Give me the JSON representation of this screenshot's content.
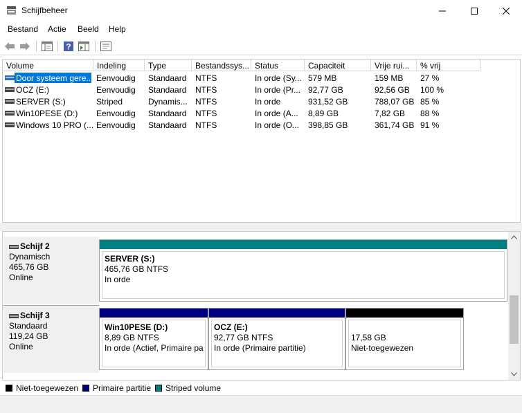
{
  "window": {
    "title": "Schijfbeheer",
    "minimize_icon": "minimize-icon",
    "maximize_icon": "maximize-icon",
    "close_icon": "close-icon"
  },
  "menu": [
    "Bestand",
    "Actie",
    "Beeld",
    "Help"
  ],
  "toolbar": [
    "back-arrow-icon",
    "forward-arrow-icon",
    "console-tree-icon",
    "help-icon",
    "action-pane-icon",
    "properties-icon"
  ],
  "volumes": {
    "columns": [
      "Volume",
      "Indeling",
      "Type",
      "Bestandssys...",
      "Status",
      "Capaciteit",
      "Vrije rui...",
      "% vrij"
    ],
    "rows": [
      {
        "volume": "Door systeem gere...",
        "indeling": "Eenvoudig",
        "type": "Standaard",
        "fs": "NTFS",
        "status": "In orde (Sy...",
        "capaciteit": "579 MB",
        "vrij": "159 MB",
        "pct": "27 %"
      },
      {
        "volume": "OCZ (E:)",
        "indeling": "Eenvoudig",
        "type": "Standaard",
        "fs": "NTFS",
        "status": "In orde (Pr...",
        "capaciteit": "92,77 GB",
        "vrij": "92,56 GB",
        "pct": "100 %"
      },
      {
        "volume": "SERVER (S:)",
        "indeling": "Striped",
        "type": "Dynamis...",
        "fs": "NTFS",
        "status": "In orde",
        "capaciteit": "931,52 GB",
        "vrij": "788,07 GB",
        "pct": "85 %"
      },
      {
        "volume": "Win10PESE (D:)",
        "indeling": "Eenvoudig",
        "type": "Standaard",
        "fs": "NTFS",
        "status": "In orde (A...",
        "capaciteit": "8,89 GB",
        "vrij": "7,82 GB",
        "pct": "88 %"
      },
      {
        "volume": "Windows 10 PRO (...",
        "indeling": "Eenvoudig",
        "type": "Standaard",
        "fs": "NTFS",
        "status": "In orde (O...",
        "capaciteit": "398,85 GB",
        "vrij": "361,74 GB",
        "pct": "91 %"
      }
    ]
  },
  "disks": [
    {
      "name": "Schijf 2",
      "type": "Dynamisch",
      "size": "465,76 GB",
      "state": "Online",
      "partitions": [
        {
          "title": "SERVER  (S:)",
          "size": "465,76 GB NTFS",
          "status": "In orde",
          "color": "#008080"
        }
      ]
    },
    {
      "name": "Schijf 3",
      "type": "Standaard",
      "size": "119,24 GB",
      "state": "Online",
      "partitions": [
        {
          "title": "Win10PESE  (D:)",
          "size": "8,89 GB NTFS",
          "status": "In orde (Actief, Primaire pa",
          "color": "#00007f"
        },
        {
          "title": "OCZ  (E:)",
          "size": "92,77 GB NTFS",
          "status": "In orde (Primaire partitie)",
          "color": "#00007f"
        },
        {
          "title": "",
          "size": "17,58 GB",
          "status": "Niet-toegewezen",
          "color": "#000000"
        }
      ]
    }
  ],
  "legend": [
    {
      "label": "Niet-toegewezen",
      "color": "#000000"
    },
    {
      "label": "Primaire partitie",
      "color": "#00007f"
    },
    {
      "label": "Striped volume",
      "color": "#008080"
    }
  ]
}
